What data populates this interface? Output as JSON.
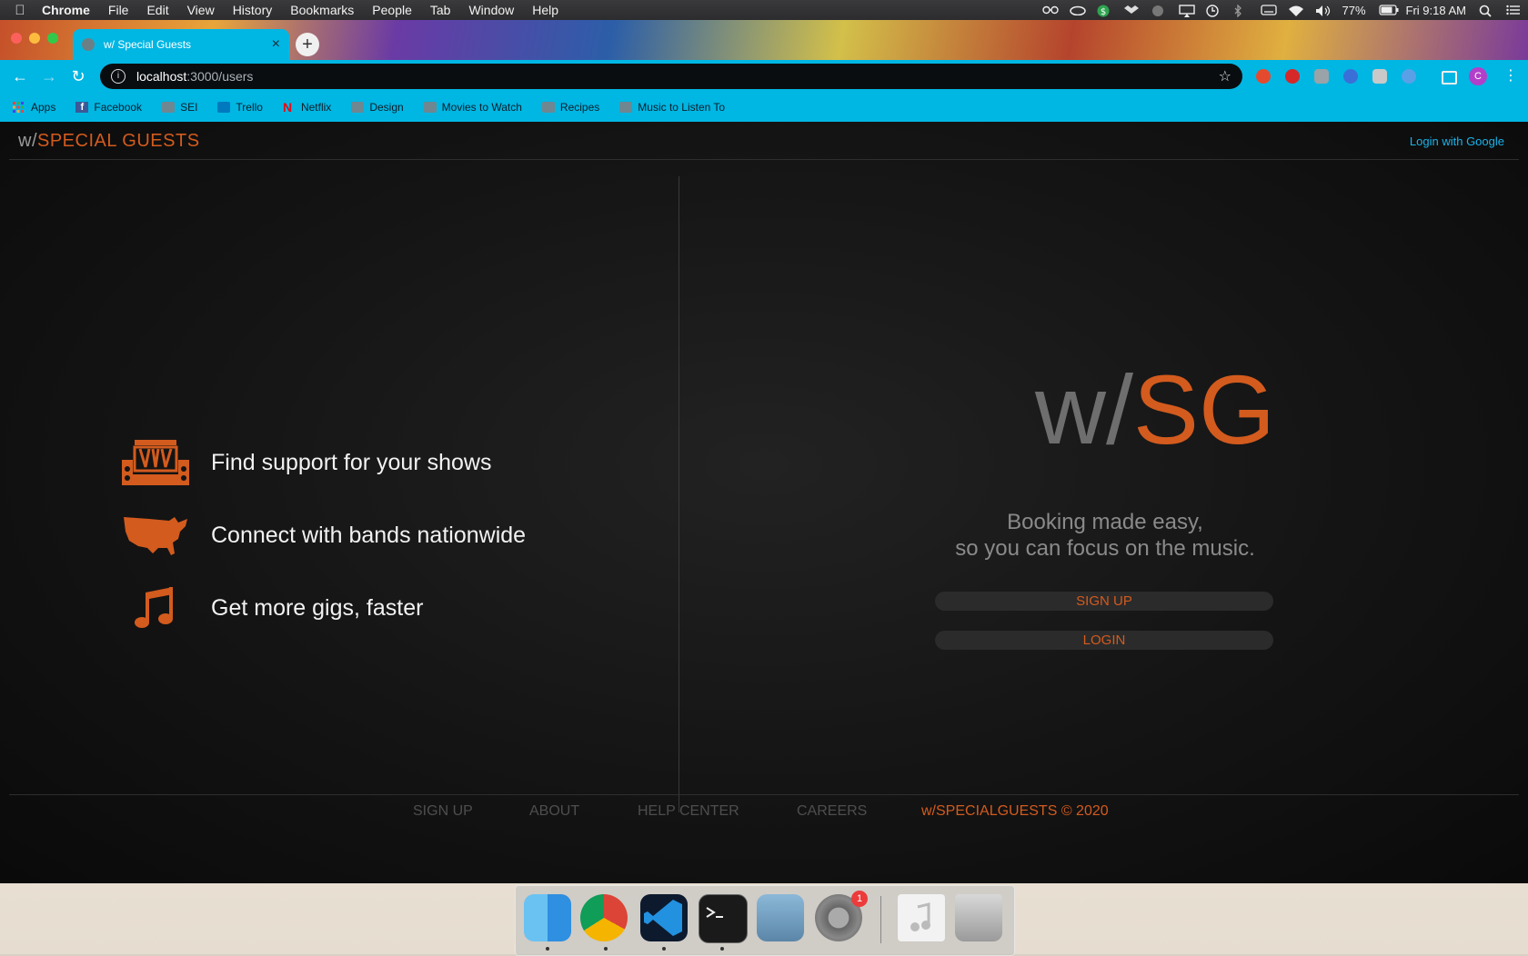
{
  "menubar": {
    "app": "Chrome",
    "items": [
      "File",
      "Edit",
      "View",
      "History",
      "Bookmarks",
      "People",
      "Tab",
      "Window",
      "Help"
    ],
    "battery": "77%",
    "clock": "Fri 9:18 AM"
  },
  "browser": {
    "tab_title": "w/ Special Guests",
    "tab_close": "×",
    "new_tab": "+",
    "url_host": "localhost",
    "url_path": ":3000/users",
    "profile_initial": "C",
    "bookmarks": [
      "Apps",
      "Facebook",
      "SEI",
      "Trello",
      "Netflix",
      "Design",
      "Movies to Watch",
      "Recipes",
      "Music to Listen To"
    ]
  },
  "site": {
    "logo_w": "w/",
    "logo_sg": "SPECIAL GUESTS",
    "google_login": "Login with Google",
    "features": [
      {
        "icon": "stage-icon",
        "text": "Find support for your shows"
      },
      {
        "icon": "usa-map-icon",
        "text": "Connect with bands nationwide"
      },
      {
        "icon": "music-note-icon",
        "text": "Get more gigs, faster"
      }
    ],
    "brand_w": "w/",
    "brand_sg": "SG",
    "tagline_1": "Booking made easy,",
    "tagline_2": "so you can focus on the music.",
    "signup": "SIGN UP",
    "login": "LOGIN",
    "footer": {
      "signup": "SIGN UP",
      "about": "ABOUT",
      "help": "HELP CENTER",
      "careers": "CAREERS",
      "copyright": "w/SPECIALGUESTS © 2020"
    },
    "accent_color": "#d35b1e",
    "link_color": "#1ab3ea"
  },
  "dock": {
    "apps": [
      "finder-icon",
      "chrome-icon",
      "vscode-icon",
      "terminal-icon",
      "preview-icon",
      "system-preferences-icon",
      "itunes-icon",
      "trash-icon"
    ],
    "badge": "1"
  }
}
